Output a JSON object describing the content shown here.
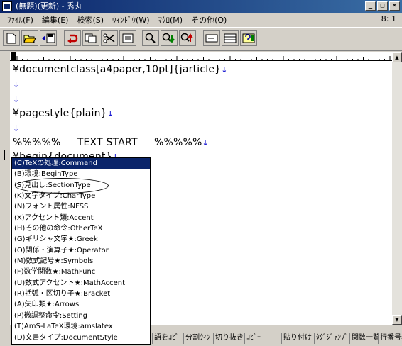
{
  "window": {
    "title": "(無題)(更新) - 秀丸",
    "position": "8: 1"
  },
  "menu": [
    "ﾌｧｲﾙ(F)",
    "編集(E)",
    "検索(S)",
    "ｳｨﾝﾄﾞｳ(W)",
    "ﾏｸﾛ(M)",
    "その他(O)"
  ],
  "editor": {
    "lines": [
      {
        "text": "¥documentclass[a4paper,10pt]{jarticle}",
        "eol": "↓"
      },
      {
        "text": "",
        "eol": "↓"
      },
      {
        "text": "",
        "eol": "↓"
      },
      {
        "text": "¥pagestyle{plain}",
        "eol": "↓"
      },
      {
        "text": "",
        "eol": "↓"
      },
      {
        "text": "%%%%%     TEXT START     %%%%%",
        "eol": "↓"
      },
      {
        "text": "¥begin{document}",
        "eol": "↓"
      }
    ]
  },
  "popup": {
    "items": [
      "(C)TeXの処理:Command",
      "(B)環境:BeginType",
      "(S)見出し:SectionType",
      "(K)文字タイプ:CharType",
      "(N)フォント属性:NFSS",
      "(X)アクセント類:Accent",
      "(H)その他の命令:OtherTeX",
      "(G)ギリシャ文字★:Greek",
      "(O)関係・演算子★:Operator",
      "(M)数式記号★:Symbols",
      "(F)数学関数★:MathFunc",
      "(U)数式アクセント★:MathAccent",
      "(R)括弧・区切り子★:Bracket",
      "(A)矢印類★:Arrows",
      "(P)微調整命令:Setting",
      "(T)AmS-LaTeX環境:amslatex",
      "(D)文書タイプ:DocumentStyle"
    ],
    "selected_index": 0
  },
  "statusbar": {
    "cells": [
      "語をｺﾋﾟ",
      "分割ｳｨﾝ",
      "切り抜き",
      "ｺﾋﾟｰ",
      "",
      "貼り付け",
      "ﾀｸﾞｼﾞｬﾝﾌﾟ",
      "関数一覧",
      "行番号表"
    ]
  }
}
